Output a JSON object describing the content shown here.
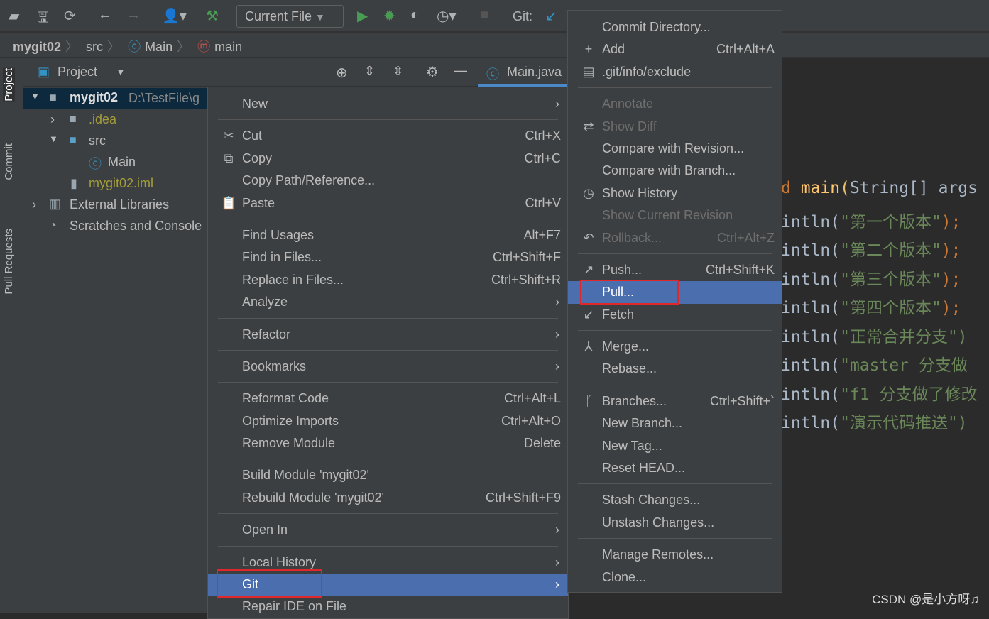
{
  "toolbar": {
    "run_config": "Current File",
    "git_label": "Git:",
    "icons": [
      "open-folder-icon",
      "save-icon",
      "sync-icon",
      "back-icon",
      "forward-icon",
      "user-icon",
      "build-hammer-icon",
      "run-icon",
      "debug-icon",
      "coverage-icon",
      "profile-icon",
      "stop-icon",
      "git-update-icon"
    ]
  },
  "breadcrumb": [
    "mygit02",
    "src",
    "Main",
    "main"
  ],
  "stripe": {
    "project": "Project",
    "commit": "Commit",
    "pull_requests": "Pull Requests"
  },
  "project_panel": {
    "title": "Project",
    "tab": "Main.java",
    "tree": [
      {
        "label": "mygit02",
        "extra": "D:\\TestFile\\g"
      },
      {
        "label": ".idea"
      },
      {
        "label": "src"
      },
      {
        "label": "Main"
      },
      {
        "label": "mygit02.iml"
      },
      {
        "label": "External Libraries"
      },
      {
        "label": "Scratches and Console"
      }
    ]
  },
  "code": {
    "lines": [
      [
        [
          "d ",
          "#cc7832"
        ],
        [
          "main",
          "#ffc66d"
        ],
        [
          "(",
          "#e8bf6a"
        ],
        [
          "String[] args",
          "#a9b7c6"
        ]
      ],
      [
        [
          "intln(",
          "#a9b7c6"
        ],
        [
          "\"第一个版本\"",
          "#6a8759"
        ],
        [
          ");",
          "#cc7832"
        ]
      ],
      [
        [
          "intln(",
          "#a9b7c6"
        ],
        [
          "\"第二个版本\"",
          "#6a8759"
        ],
        [
          ");",
          "#cc7832"
        ]
      ],
      [
        [
          "intln(",
          "#a9b7c6"
        ],
        [
          "\"第三个版本\"",
          "#6a8759"
        ],
        [
          ");",
          "#cc7832"
        ]
      ],
      [
        [
          "intln(",
          "#a9b7c6"
        ],
        [
          "\"第四个版本\"",
          "#6a8759"
        ],
        [
          ");",
          "#cc7832"
        ]
      ],
      [
        [
          "intln(",
          "#a9b7c6"
        ],
        [
          "\"正常合并分支\")",
          "#6a8759"
        ]
      ],
      [
        [
          "intln(",
          "#a9b7c6"
        ],
        [
          "\"master 分支做",
          "#6a8759"
        ]
      ],
      [
        [
          "intln(",
          "#a9b7c6"
        ],
        [
          "\"f1 分支做了修改",
          "#6a8759"
        ]
      ],
      [
        [
          "intln(",
          "#a9b7c6"
        ],
        [
          "\"演示代码推送\")",
          "#6a8759"
        ]
      ]
    ]
  },
  "context_menu": [
    {
      "label": "New",
      "submenu": true
    },
    "-",
    {
      "label": "Cut",
      "shortcut": "Ctrl+X",
      "icon": "✂"
    },
    {
      "label": "Copy",
      "shortcut": "Ctrl+C",
      "icon": "⧉"
    },
    {
      "label": "Copy Path/Reference..."
    },
    {
      "label": "Paste",
      "shortcut": "Ctrl+V",
      "icon": "📋"
    },
    "-",
    {
      "label": "Find Usages",
      "shortcut": "Alt+F7"
    },
    {
      "label": "Find in Files...",
      "shortcut": "Ctrl+Shift+F"
    },
    {
      "label": "Replace in Files...",
      "shortcut": "Ctrl+Shift+R"
    },
    {
      "label": "Analyze",
      "submenu": true
    },
    "-",
    {
      "label": "Refactor",
      "submenu": true
    },
    "-",
    {
      "label": "Bookmarks",
      "submenu": true
    },
    "-",
    {
      "label": "Reformat Code",
      "shortcut": "Ctrl+Alt+L"
    },
    {
      "label": "Optimize Imports",
      "shortcut": "Ctrl+Alt+O"
    },
    {
      "label": "Remove Module",
      "shortcut": "Delete"
    },
    "-",
    {
      "label": "Build Module 'mygit02'"
    },
    {
      "label": "Rebuild Module 'mygit02'",
      "shortcut": "Ctrl+Shift+F9"
    },
    "-",
    {
      "label": "Open In",
      "submenu": true
    },
    "-",
    {
      "label": "Local History",
      "submenu": true
    },
    {
      "label": "Git",
      "submenu": true,
      "selected": true
    },
    {
      "label": "Repair IDE on File"
    }
  ],
  "git_menu": [
    {
      "label": "Commit Directory..."
    },
    {
      "label": "Add",
      "shortcut": "Ctrl+Alt+A",
      "icon": "+"
    },
    {
      "label": ".git/info/exclude",
      "icon": "▤"
    },
    "-",
    {
      "label": "Annotate",
      "disabled": true
    },
    {
      "label": "Show Diff",
      "disabled": true,
      "icon": "⇄"
    },
    {
      "label": "Compare with Revision..."
    },
    {
      "label": "Compare with Branch..."
    },
    {
      "label": "Show History",
      "icon": "◷"
    },
    {
      "label": "Show Current Revision",
      "disabled": true
    },
    {
      "label": "Rollback...",
      "shortcut": "Ctrl+Alt+Z",
      "disabled": true,
      "icon": "↶"
    },
    "-",
    {
      "label": "Push...",
      "shortcut": "Ctrl+Shift+K",
      "icon": "↗"
    },
    {
      "label": "Pull...",
      "selected": true
    },
    {
      "label": "Fetch",
      "icon": "↙"
    },
    "-",
    {
      "label": "Merge...",
      "icon": "⅄"
    },
    {
      "label": "Rebase..."
    },
    "-",
    {
      "label": "Branches...",
      "shortcut": "Ctrl+Shift+`",
      "icon": "ᚴ"
    },
    {
      "label": "New Branch..."
    },
    {
      "label": "New Tag..."
    },
    {
      "label": "Reset HEAD..."
    },
    "-",
    {
      "label": "Stash Changes..."
    },
    {
      "label": "Unstash Changes..."
    },
    "-",
    {
      "label": "Manage Remotes..."
    },
    {
      "label": "Clone..."
    }
  ],
  "watermark": "CSDN @是小方呀♫",
  "colors": {
    "selection": "#4b6eaf",
    "highlight_box": "#e0272a"
  }
}
